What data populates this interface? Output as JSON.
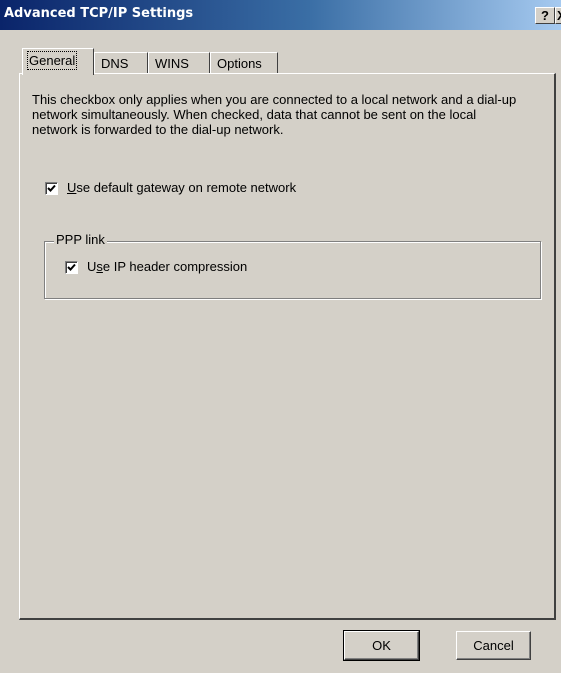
{
  "window": {
    "title": "Advanced TCP/IP Settings",
    "help_glyph": "?",
    "close_glyph": "X"
  },
  "tabs": [
    {
      "label": "General",
      "active": true
    },
    {
      "label": "DNS",
      "active": false
    },
    {
      "label": "WINS",
      "active": false
    },
    {
      "label": "Options",
      "active": false
    }
  ],
  "general": {
    "description": "This checkbox only applies when you are connected to a local network and a dial-up network simultaneously.  When checked, data that cannot be sent on the local network is forwarded to the dial-up network.",
    "default_gateway": {
      "label_access": "U",
      "label_rest": "se default gateway on remote network",
      "checked": true
    },
    "ppp_group": {
      "legend": "PPP link",
      "ip_header": {
        "label_pre": "U",
        "label_access": "s",
        "label_rest": "e IP header compression",
        "checked": true
      }
    }
  },
  "buttons": {
    "ok": "OK",
    "cancel": "Cancel"
  },
  "colors": {
    "title_gradient_start": "#0a246a",
    "title_gradient_end": "#a6caf0",
    "face": "#d4d0c8"
  }
}
